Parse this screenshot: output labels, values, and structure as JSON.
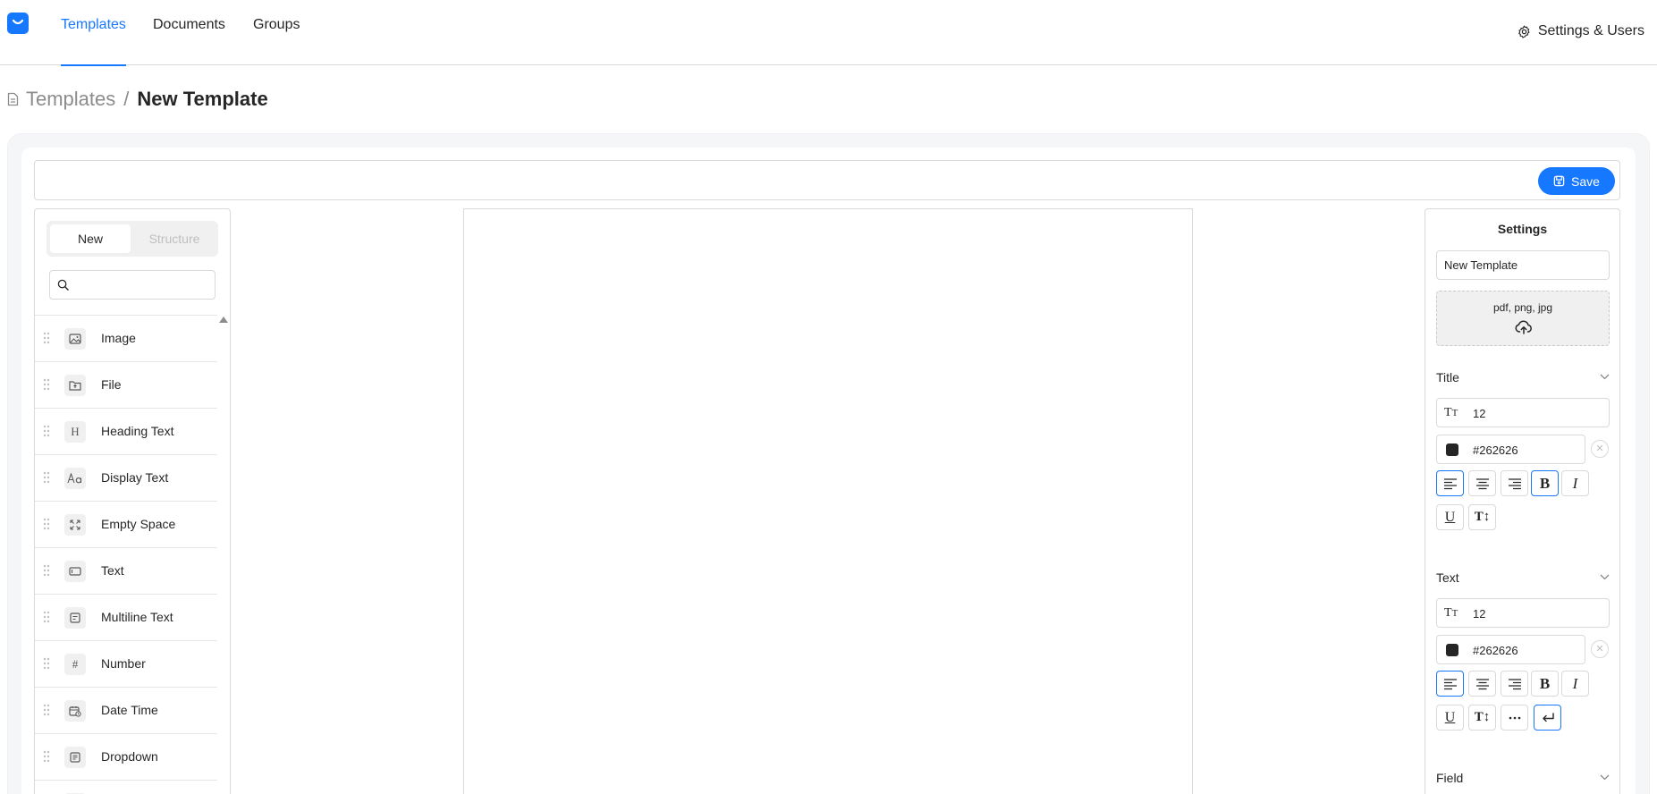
{
  "nav": {
    "tabs": [
      {
        "label": "Templates",
        "active": true
      },
      {
        "label": "Documents",
        "active": false
      },
      {
        "label": "Groups",
        "active": false
      }
    ],
    "settings_label": "Settings & Users"
  },
  "breadcrumb": {
    "parent": "Templates",
    "separator": "/",
    "current": "New Template"
  },
  "toolbar": {
    "save_label": "Save"
  },
  "left_panel": {
    "tabs": {
      "new": "New",
      "structure": "Structure"
    },
    "search": {
      "value": "",
      "placeholder": ""
    },
    "items": [
      {
        "label": "Image",
        "icon": "image-icon"
      },
      {
        "label": "File",
        "icon": "file-icon"
      },
      {
        "label": "Heading Text",
        "icon": "heading-icon"
      },
      {
        "label": "Display Text",
        "icon": "display-text-icon"
      },
      {
        "label": "Empty Space",
        "icon": "empty-space-icon"
      },
      {
        "label": "Text",
        "icon": "text-field-icon"
      },
      {
        "label": "Multiline Text",
        "icon": "multiline-text-icon"
      },
      {
        "label": "Number",
        "icon": "number-icon"
      },
      {
        "label": "Date Time",
        "icon": "date-time-icon"
      },
      {
        "label": "Dropdown",
        "icon": "dropdown-icon"
      }
    ]
  },
  "settings": {
    "title": "Settings",
    "name_value": "New Template",
    "upload_types": "pdf, png, jpg",
    "sections": {
      "title": {
        "label": "Title",
        "font_size": "12",
        "color": "#262626",
        "align": "left",
        "bold": true,
        "italic": false,
        "underline": false
      },
      "text": {
        "label": "Text",
        "font_size": "12",
        "color": "#262626",
        "align": "left",
        "bold": false,
        "italic": false,
        "underline": false,
        "wrap": true
      },
      "field": {
        "label": "Field"
      }
    }
  },
  "colors": {
    "accent": "#1677ff",
    "text": "#262626",
    "muted": "#8c8c8c",
    "border": "#d9d9d9"
  }
}
